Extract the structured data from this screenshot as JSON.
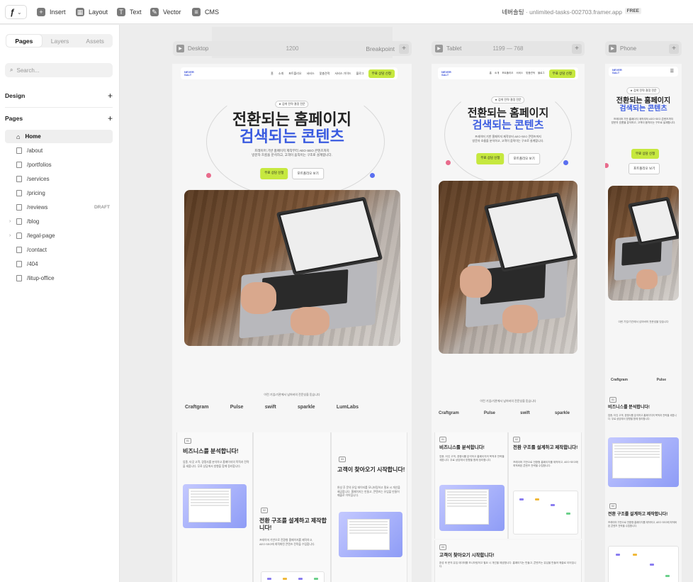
{
  "app": {
    "toolbar": {
      "insert": "Insert",
      "layout": "Layout",
      "text": "Text",
      "vector": "Vector",
      "cms": "CMS"
    },
    "project_name": "네버솔팅",
    "project_sep": "·",
    "project_domain": "unlimited-tasks-002703.framer.app",
    "plan_badge": "FREE"
  },
  "sidebar": {
    "tabs": [
      "Pages",
      "Layers",
      "Assets"
    ],
    "search_placeholder": "Search...",
    "design_label": "Design",
    "pages_label": "Pages",
    "pages": [
      {
        "label": "Home",
        "icon": "home-icon"
      },
      {
        "label": "/about",
        "icon": "page-icon"
      },
      {
        "label": "/portfolios",
        "icon": "page-icon"
      },
      {
        "label": "/services",
        "icon": "page-icon"
      },
      {
        "label": "/pricing",
        "icon": "page-icon"
      },
      {
        "label": "/reviews",
        "icon": "page-icon",
        "tag": "DRAFT"
      },
      {
        "label": "/blog",
        "icon": "page-icon",
        "expandable": true
      },
      {
        "label": "/legal-page",
        "icon": "folder-icon",
        "expandable": true
      },
      {
        "label": "/contact",
        "icon": "page-icon"
      },
      {
        "label": "/404",
        "icon": "page-icon"
      },
      {
        "label": "/litup-office",
        "icon": "page-icon"
      }
    ]
  },
  "frames": {
    "desktop": {
      "name": "Desktop",
      "size": "1200",
      "breakpoint_label": "Breakpoint"
    },
    "tablet": {
      "name": "Tablet",
      "size": "1199 — 768"
    },
    "phone": {
      "name": "Phone"
    }
  },
  "site": {
    "logo_line1": "NEVER",
    "logo_line2": "SALT",
    "nav_links": [
      "홈",
      "소개",
      "포트폴리오",
      "서비스",
      "맞춤견적",
      "서비스 가이드",
      "블로그"
    ],
    "nav_cta": "무료 상담 신청",
    "pill": "★ 검색 전략 결정 전문",
    "headline_line1": "전환되는 홈페이지",
    "headline_line2": "검색되는 콘텐츠",
    "subtext_line1": "프레이머 기반 홈페이지 제작부터 AEO·SEO 콘텐츠까지",
    "subtext_line2": "방문자 흐름을 분석하고, 고객이 움직이는 구조로 설계합니다.",
    "cta_primary": "무료 상담 신청",
    "cta_secondary": "포트폴리오 보기",
    "trusted_text": "이런 기업/기관에서 넘어버의 전문성을 믿습니다",
    "logos": [
      "Craftgram",
      "Pulse",
      "swift",
      "sparkle",
      "LumLabs"
    ],
    "cards": [
      {
        "num": "01",
        "title": "비즈니스를 분석합니다!",
        "body": "업종, 타깃 고객, 경쟁사를 분석하고 홈페이지의 목적과 전략을 세웁니다. 무료 상담에서 방향을 함께 정리합니다."
      },
      {
        "num": "02",
        "title": "전환 구조를 설계하고 제작합니다!",
        "body": "프레이머 기반으로 전환형 홈페이지를 제작하고, AEO·SEO에 최적화된 콘텐츠 전략을 수립합니다."
      },
      {
        "num": "03",
        "title": "고객이 찾아오기 시작합니다!",
        "body": "완성 후 문의 유입 데이터를 모니터링하고 필요 시 개선을 제공합니다. 홈페이지는 만들고, 콘텐츠는 유입을 만들어 매출로 이어집니다."
      }
    ]
  }
}
